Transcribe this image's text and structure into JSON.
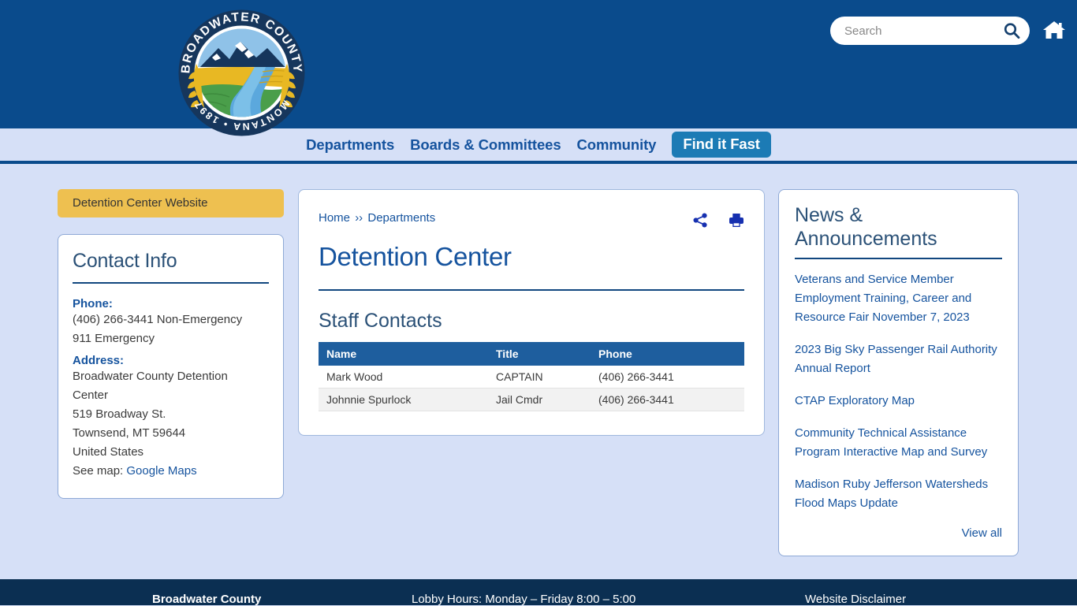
{
  "header": {
    "logo_alt": "Broadwater County Montana 1897 seal",
    "logo_top_text": "BROADWATER COUNTY",
    "logo_bottom_text": "MONTANA • 1897",
    "search": {
      "placeholder": "Search",
      "value": "",
      "button_label": "Search"
    },
    "home_label": "Home",
    "colors": {
      "header_blue": "#0a4b8c",
      "nav_band": "#d6e0f7",
      "accent_blue": "#15539e",
      "pill_blue": "#1c7bb5",
      "gold": "#eec050",
      "footer_navy": "#0b2f52"
    }
  },
  "nav": {
    "items": [
      {
        "label": "Departments",
        "highlight": false
      },
      {
        "label": "Boards & Committees",
        "highlight": false
      },
      {
        "label": "Community",
        "highlight": false
      },
      {
        "label": "Find it Fast",
        "highlight": true
      }
    ]
  },
  "sidebar": {
    "website_button": "Detention Center Website",
    "contact": {
      "title": "Contact Info",
      "phone_label": "Phone:",
      "phone_lines": [
        "(406) 266-3441 Non-Emergency",
        "911 Emergency"
      ],
      "address_label": "Address:",
      "address_lines": [
        "Broadwater County Detention",
        "Center",
        "519 Broadway St.",
        "Townsend, MT 59644",
        "United States"
      ],
      "map_prefix": "See map:",
      "map_link": "Google Maps"
    }
  },
  "main": {
    "breadcrumb": {
      "home": "Home",
      "separator": "››",
      "current": "Departments"
    },
    "share_label": "Share",
    "print_label": "Print",
    "title": "Detention Center",
    "staff_section_title": "Staff Contacts",
    "table": {
      "columns": [
        "Name",
        "Title",
        "Phone"
      ],
      "rows": [
        {
          "name": "Mark Wood",
          "title": "CAPTAIN",
          "phone": "(406) 266-3441"
        },
        {
          "name": "Johnnie Spurlock",
          "title": "Jail Cmdr",
          "phone": "(406) 266-3441"
        }
      ]
    }
  },
  "news": {
    "title": "News & Announcements",
    "items": [
      "Veterans and Service Member Employment Training, Career and Resource Fair November 7, 2023",
      "2023 Big Sky Passenger Rail Authority Annual Report",
      "CTAP Exploratory Map",
      "Community Technical Assistance Program Interactive Map and Survey",
      "Madison Ruby Jefferson Watersheds Flood Maps Update"
    ],
    "view_all": "View all"
  },
  "footer": {
    "county": "Broadwater County",
    "hours": "Lobby Hours: Monday – Friday 8:00 – 5:00",
    "disclaimer": "Website Disclaimer"
  }
}
